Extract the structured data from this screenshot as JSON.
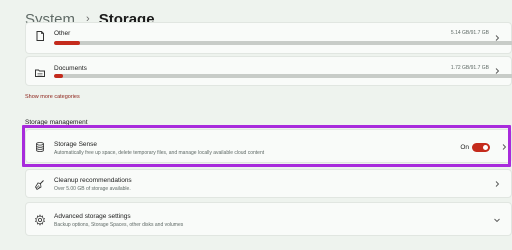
{
  "breadcrumb": {
    "parent": "System",
    "separator": "›",
    "current": "Storage"
  },
  "storage_items": [
    {
      "name": "Other",
      "size": "5.14 GB/91.7 GB",
      "usage_fraction": 0.056
    },
    {
      "name": "Documents",
      "size": "1.72 GB/91.7 GB",
      "usage_fraction": 0.019
    }
  ],
  "show_more_link": "Show more categories",
  "storage_management": {
    "heading": "Storage management",
    "storage_sense": {
      "title": "Storage Sense",
      "description": "Automatically free up space, delete temporary files, and manage locally available cloud content",
      "toggle_label": "On",
      "toggle_on": true
    },
    "cleanup": {
      "title": "Cleanup recommendations",
      "description": "Over 5.00 GB of storage available."
    },
    "advanced": {
      "title": "Advanced storage settings",
      "description": "Backup options, Storage Spaces, other disks and volumes"
    }
  },
  "colors": {
    "accent": "#c42b1c",
    "highlight": "#a82bdc",
    "background": "#eef3ee"
  },
  "icons": {
    "other": "document-icon",
    "documents": "folder-icon",
    "storage_sense": "database-icon",
    "cleanup": "broom-icon",
    "advanced": "gear-icon"
  }
}
